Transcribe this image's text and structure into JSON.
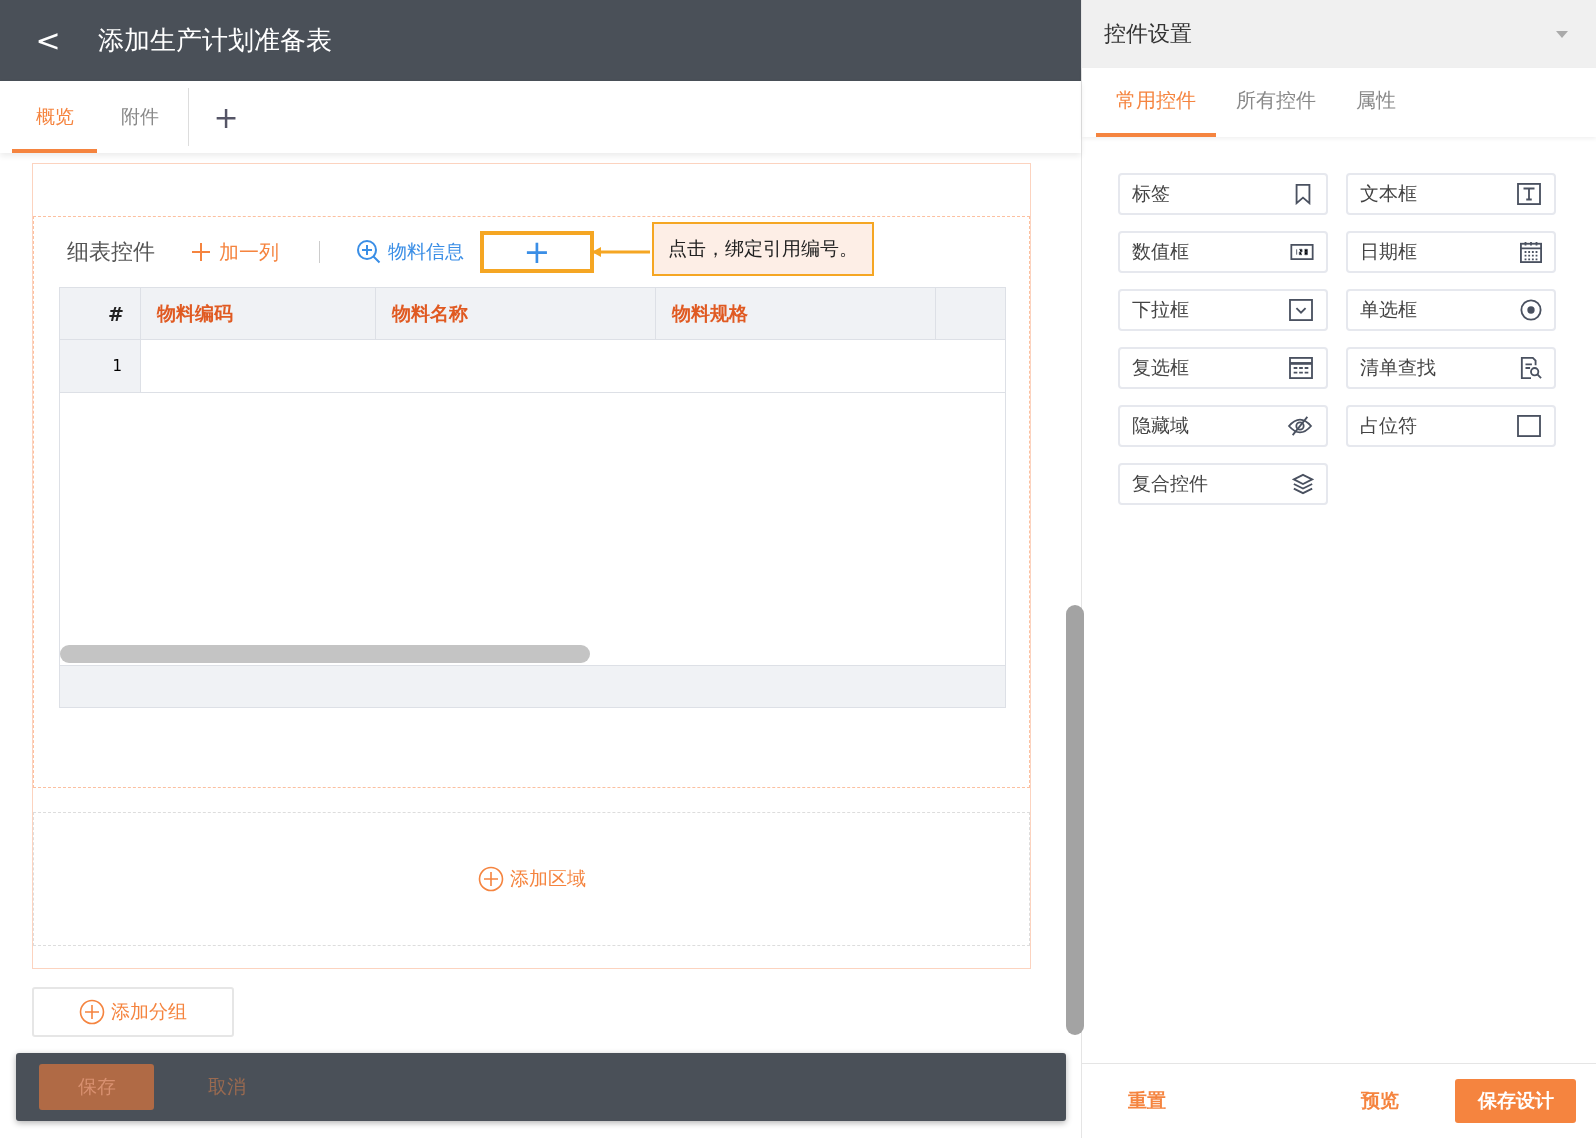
{
  "header": {
    "back": "<",
    "title": "添加生产计划准备表"
  },
  "tabs": [
    {
      "label": "概览",
      "selected": true
    },
    {
      "label": "附件",
      "selected": false
    }
  ],
  "tab_add": "+",
  "detail": {
    "title": "细表控件",
    "add_column": "加一列",
    "material_info": "物料信息",
    "bind_button": "+",
    "callout": "点击，绑定引用编号。",
    "columns": [
      "#",
      "物料编码",
      "物料名称",
      "物料规格"
    ],
    "rows": [
      {
        "index": "1"
      }
    ]
  },
  "add_area": "添加区域",
  "add_group": "添加分组",
  "footer_buttons": [
    {
      "label": "保存",
      "kind": "primary"
    },
    {
      "label": "取消",
      "kind": "text"
    }
  ],
  "panel": {
    "title": "控件设置",
    "tabs": [
      {
        "label": "常用控件",
        "selected": true
      },
      {
        "label": "所有控件",
        "selected": false
      },
      {
        "label": "属性",
        "selected": false
      }
    ],
    "controls": [
      {
        "label": "标签",
        "kind": "bookmark"
      },
      {
        "label": "文本框",
        "kind": "text"
      },
      {
        "label": "数值框",
        "kind": "number"
      },
      {
        "label": "日期框",
        "kind": "calendar"
      },
      {
        "label": "下拉框",
        "kind": "dropdown"
      },
      {
        "label": "单选框",
        "kind": "radio"
      },
      {
        "label": "复选框",
        "kind": "table"
      },
      {
        "label": "清单查找",
        "kind": "search-doc"
      },
      {
        "label": "隐藏域",
        "kind": "hidden"
      },
      {
        "label": "占位符",
        "kind": "placeholder"
      },
      {
        "label": "复合控件",
        "kind": "layers"
      }
    ],
    "actions": [
      {
        "label": "重置",
        "kind": "text"
      },
      {
        "label": "预览",
        "kind": "text"
      },
      {
        "label": "保存设计",
        "kind": "primary"
      }
    ]
  }
}
